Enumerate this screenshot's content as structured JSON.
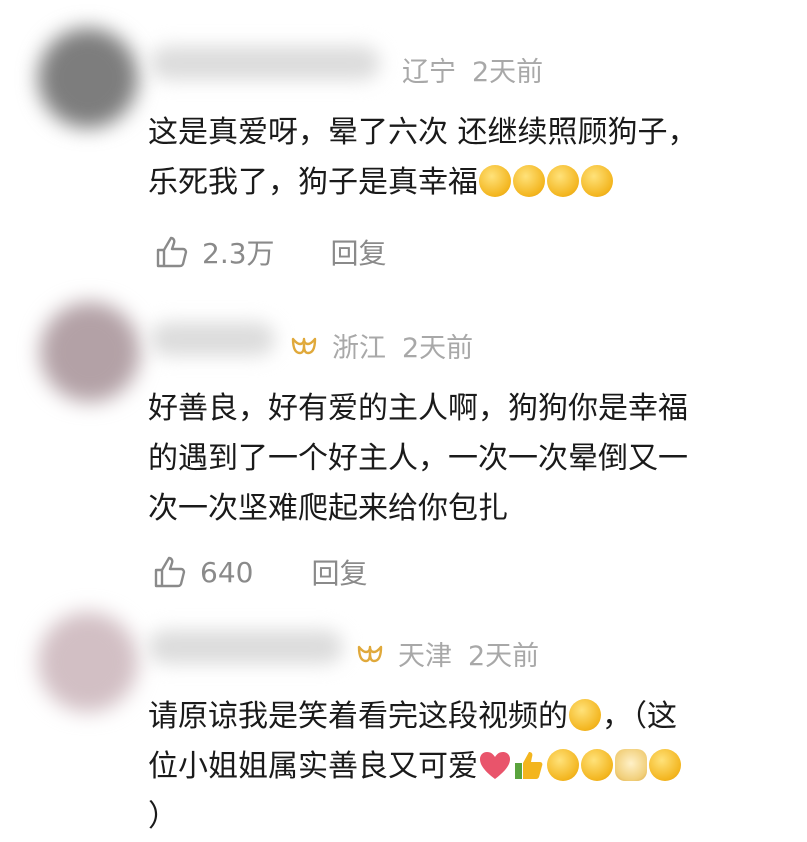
{
  "comments": [
    {
      "region": "辽宁",
      "time": "2天前",
      "vip": false,
      "text_before_emoji": "这是真爱呀，晕了六次 还继续照顾狗子，\n乐死我了，狗子是真幸福",
      "emojis": [
        "laugh-cry-emoji",
        "laugh-cry-emoji",
        "laugh-cry-emoji",
        "laugh-cry-emoji"
      ],
      "likes": "2.3万",
      "reply_label": "回复",
      "avatar_color": "#7d7d7d"
    },
    {
      "region": "浙江",
      "time": "2天前",
      "vip": true,
      "text": "好善良，好有爱的主人啊，狗狗你是幸福\n的遇到了一个好主人，一次一次晕倒又一\n次一次坚难爬起来给你包扎",
      "likes": "640",
      "reply_label": "回复",
      "avatar_color": "#b3a1a6"
    },
    {
      "region": "天津",
      "time": "2天前",
      "vip": true,
      "text_line1": "请原谅我是笑着看完这段视频的",
      "text_line1_tail": "，（这",
      "text_line2": "位小姐姐属实善良又可爱",
      "text_line3": "）",
      "emojis_line2": [
        "heart-emoji",
        "thumbs-up-emoji",
        "cheer-emoji",
        "grin-emoji",
        "doge-emoji",
        "laugh-cry-emoji"
      ],
      "avatar_color": "#d2bfc4"
    }
  ]
}
